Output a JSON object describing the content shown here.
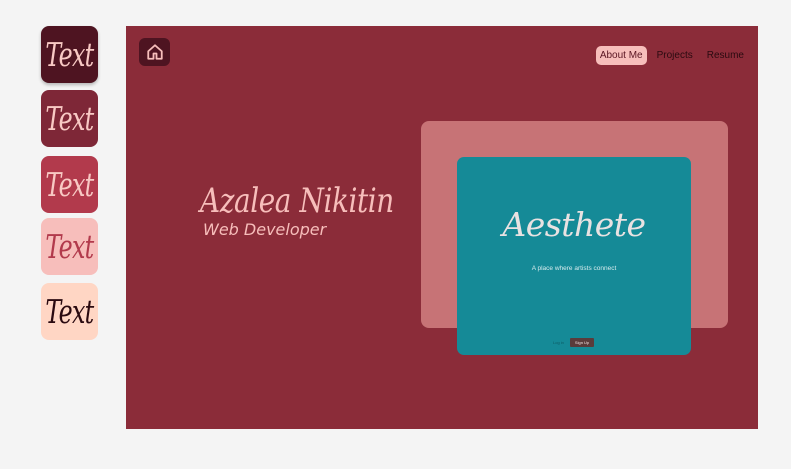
{
  "palette": {
    "swatches": [
      {
        "label": "Text",
        "background": "#4e1421",
        "text_color": "#f8c9c4"
      },
      {
        "label": "Text",
        "background": "#7e2737",
        "text_color": "#f8c9c4"
      },
      {
        "label": "Text",
        "background": "#b23a4c",
        "text_color": "#f8c9c4"
      },
      {
        "label": "Text",
        "background": "#f7bebb",
        "text_color": "#b23a4c"
      },
      {
        "label": "Text",
        "background": "#ffd6c4",
        "text_color": "#2a0a10"
      }
    ]
  },
  "header": {
    "home_icon": "home-icon",
    "nav": [
      {
        "label": "About Me",
        "active": true
      },
      {
        "label": "Projects",
        "active": false
      },
      {
        "label": "Resume",
        "active": false
      }
    ]
  },
  "hero": {
    "name": "Azalea Nikitin",
    "role": "Web Developer"
  },
  "project_card": {
    "title": "Aesthete",
    "tagline": "A place where artists connect",
    "login_label": "Log in",
    "signup_label": "Sign Up",
    "accent": "#158a97",
    "backdrop": "#c77376"
  },
  "colors": {
    "page_background": "#8b2c39",
    "outer_background": "#f4f4f4"
  }
}
